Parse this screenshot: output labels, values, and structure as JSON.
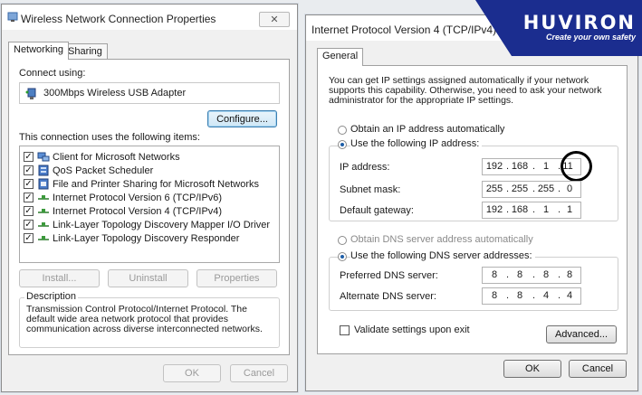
{
  "win1": {
    "title": "Wireless Network Connection Properties",
    "tabs": [
      "Networking",
      "Sharing"
    ],
    "connect_using_label": "Connect using:",
    "adapter": "300Mbps Wireless USB Adapter",
    "configure_label": "Configure...",
    "items_label": "This connection uses the following items:",
    "items": [
      {
        "label": "Client for Microsoft Networks",
        "icon": "network-client-icon"
      },
      {
        "label": "QoS Packet Scheduler",
        "icon": "scheduler-icon"
      },
      {
        "label": "File and Printer Sharing for Microsoft Networks",
        "icon": "file-printer-icon"
      },
      {
        "label": "Internet Protocol Version 6 (TCP/IPv6)",
        "icon": "protocol-icon"
      },
      {
        "label": "Internet Protocol Version 4 (TCP/IPv4)",
        "icon": "protocol-icon"
      },
      {
        "label": "Link-Layer Topology Discovery Mapper I/O Driver",
        "icon": "protocol-icon"
      },
      {
        "label": "Link-Layer Topology Discovery Responder",
        "icon": "protocol-icon"
      }
    ],
    "install_label": "Install...",
    "uninstall_label": "Uninstall",
    "properties_label": "Properties",
    "description_label": "Description",
    "description_text": "Transmission Control Protocol/Internet Protocol. The default wide area network protocol that provides communication across diverse interconnected networks.",
    "ok_label": "OK",
    "cancel_label": "Cancel"
  },
  "win2": {
    "title": "Internet Protocol Version 4 (TCP/IPv4) Pr",
    "tab": "General",
    "intro_text": "You can get IP settings assigned automatically if your network supports this capability. Otherwise, you need to ask your network administrator for the appropriate IP settings.",
    "obtain_ip_label": "Obtain an IP address automatically",
    "use_ip_label": "Use the following IP address:",
    "ip_label": "IP address:",
    "ip": [
      "192",
      "168",
      "1",
      "11"
    ],
    "subnet_label": "Subnet mask:",
    "subnet": [
      "255",
      "255",
      "255",
      "0"
    ],
    "gateway_label": "Default gateway:",
    "gateway": [
      "192",
      "168",
      "1",
      "1"
    ],
    "obtain_dns_label": "Obtain DNS server address automatically",
    "use_dns_label": "Use the following DNS server addresses:",
    "preferred_dns_label": "Preferred DNS server:",
    "preferred_dns": [
      "8",
      "8",
      "8",
      "8"
    ],
    "alternate_dns_label": "Alternate DNS server:",
    "alternate_dns": [
      "8",
      "8",
      "4",
      "4"
    ],
    "validate_label": "Validate settings upon exit",
    "advanced_label": "Advanced...",
    "ok_label": "OK",
    "cancel_label": "Cancel"
  },
  "brand": {
    "name": "HUVIRON",
    "tagline": "Create your own safety",
    "color": "#1b2d8f"
  }
}
